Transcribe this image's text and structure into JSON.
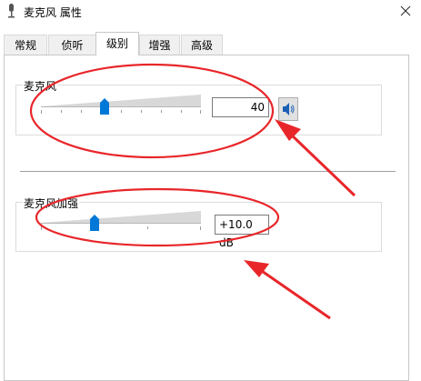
{
  "window": {
    "title": "麦克风 属性",
    "icon": "microphone-icon",
    "close_icon": "close-icon"
  },
  "tabs": [
    {
      "label": "常规",
      "active": false
    },
    {
      "label": "侦听",
      "active": false
    },
    {
      "label": "级别",
      "active": true
    },
    {
      "label": "增强",
      "active": false
    },
    {
      "label": "高级",
      "active": false
    }
  ],
  "microphone": {
    "label": "麦克风",
    "value": "40",
    "level_fraction": 0.4,
    "mute_icon": "speaker-icon"
  },
  "boost": {
    "label": "麦克风加强",
    "value": "+10.0 dB",
    "level_fraction": 0.33
  },
  "colors": {
    "accent": "#0078d7",
    "annotation": "#e8262a"
  }
}
